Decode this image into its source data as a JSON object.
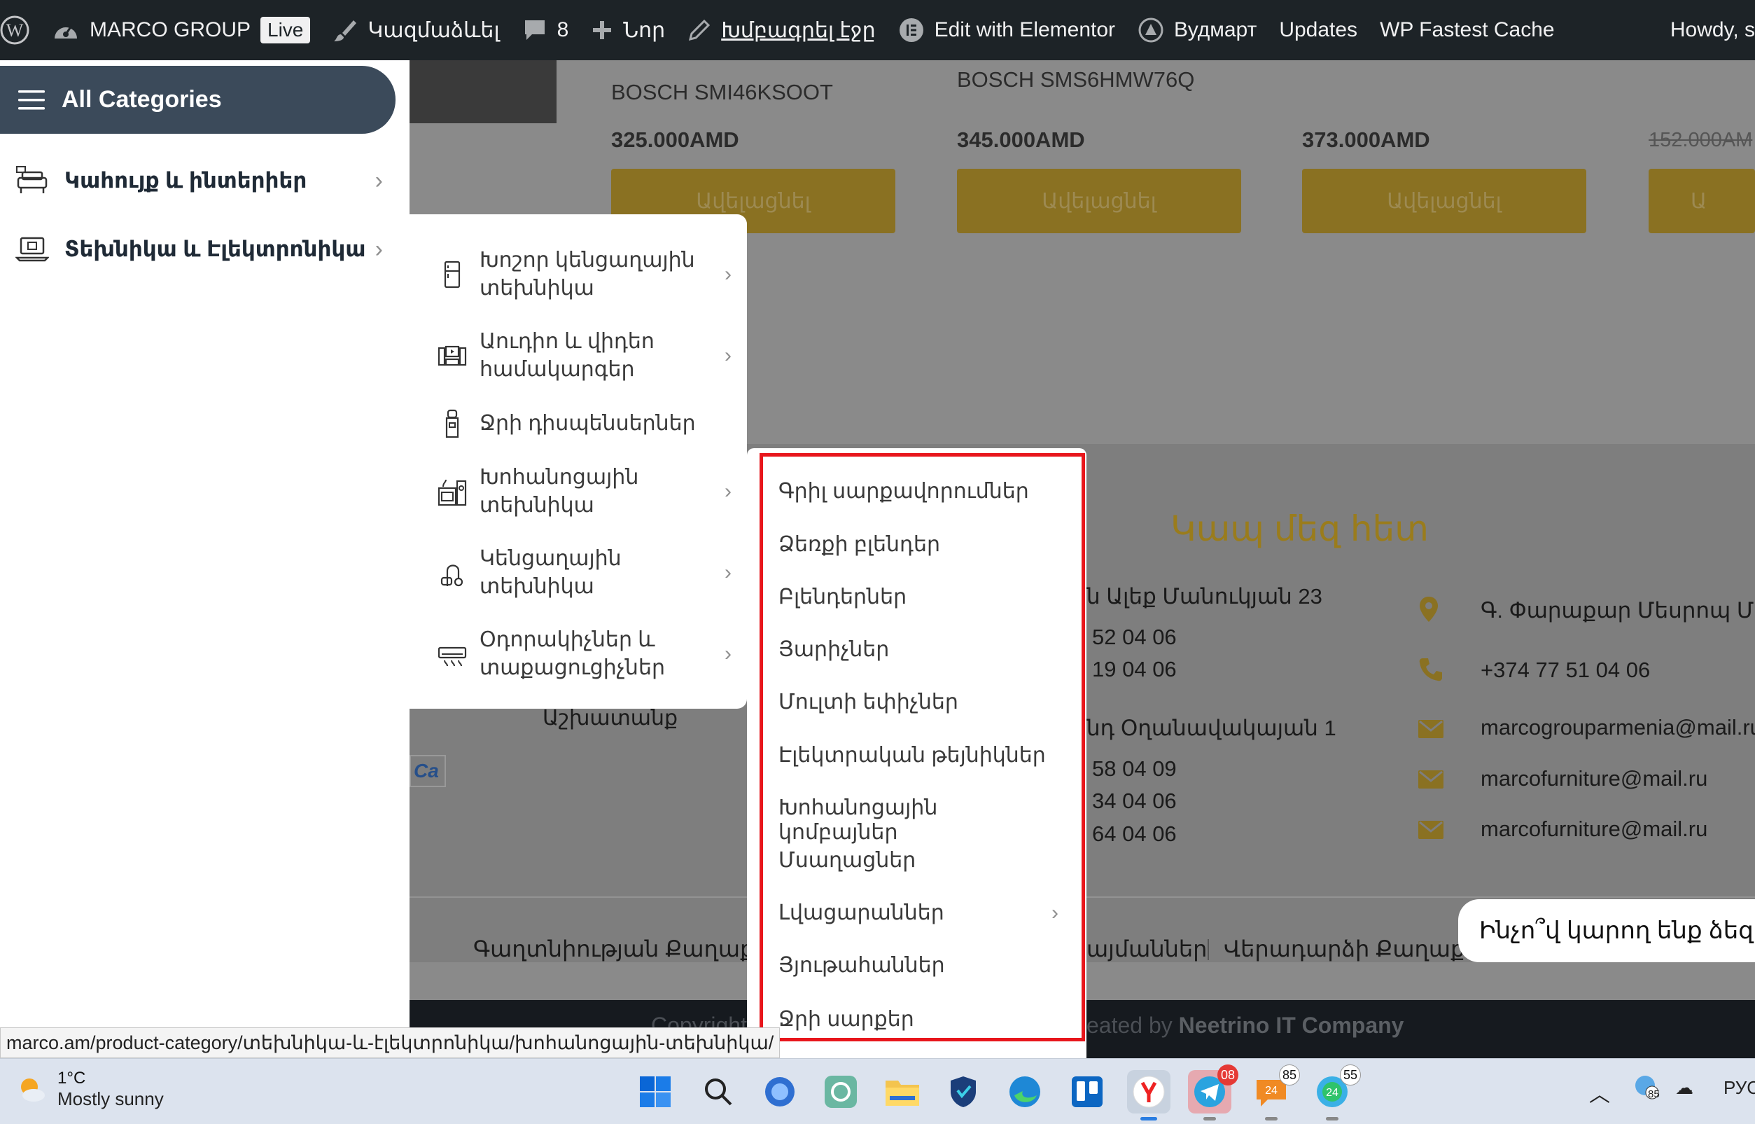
{
  "adminbar": {
    "site_name": "MARCO GROUP",
    "live_label": "Live",
    "customize_label": "Կազմաձևել",
    "comments_count": "8",
    "new_label": "Նոր",
    "edit_page_label": "Խմբագրել էջը",
    "elementor_label": "Edit with Elementor",
    "theme_label": "Вудмарт",
    "updates_label": "Updates",
    "cache_label": "WP Fastest Cache",
    "howdy_label": "Howdy, s"
  },
  "products": [
    {
      "name": "BOSCH SMI46KSOOT",
      "price": "325.000AMD",
      "button": "Ավելացնել"
    },
    {
      "name": "BOSCH SMS6HMW76Q",
      "price": "345.000AMD",
      "button": "Ավելացնել"
    },
    {
      "name": "",
      "price": "373.000AMD",
      "button": "Ավելացնել"
    },
    {
      "name": "",
      "price": "152.000AM",
      "button": "Ա"
    }
  ],
  "footer": {
    "contact_title": "Կապ մեզ հետ",
    "addr1": "ն Ալեք Մանուկյան 23",
    "phone1a": "52 04 06",
    "phone1b": "19 04 06",
    "addr2": "նդ Օղանավակայան 1",
    "phone2a": "58 04 09",
    "phone2b": "34 04 06",
    "phone2c": "64 04 06",
    "addr3": "Գ. Փարաքար Մեսրոպ Մաշ",
    "phone3": "+374 77 51 04 06",
    "email1": "marcogrouparmenia@mail.ru",
    "email2": "marcofurniture@mail.ru",
    "email3": "marcofurniture@mail.ru",
    "work_label": "Աշխատանք",
    "pay_badge": "Ca",
    "link_privacy": "Գաղտնիության Քաղաքա",
    "link_terms": "այմաններ",
    "link_return": "Վերադարձի Քաղաքա",
    "copyright_pre": "Copyright",
    "copyright_mid": "eated by ",
    "copyright_company": "Neetrino IT Company"
  },
  "chat": {
    "text": "Ինչո՞վ կարող ենք ձեզ օ"
  },
  "sidebar": {
    "all_categories": "All Categories",
    "items": [
      {
        "label": "Կահույք և ինտերիեր",
        "icon": "furniture-icon"
      },
      {
        "label": "Տեխնիկա և Էլեկտրոնիկա",
        "icon": "laptop-icon"
      }
    ]
  },
  "dropdown_level2": [
    {
      "line1": "Խոշոր կենցաղային",
      "line2": "տեխնիկա",
      "icon": "fridge-icon",
      "has_children": true
    },
    {
      "line1": "Աուդիո և վիդեո",
      "line2": "համակարգեր",
      "icon": "audio-video-icon",
      "has_children": true
    },
    {
      "line1": "Ջրի դիսպենսերներ",
      "line2": "",
      "icon": "water-dispenser-icon",
      "has_children": false
    },
    {
      "line1": "Խոհանոցային",
      "line2": "տեխնիկա",
      "icon": "kitchen-appliance-icon",
      "has_children": true
    },
    {
      "line1": "Կենցաղային",
      "line2": "տեխնիկա",
      "icon": "vacuum-icon",
      "has_children": true
    },
    {
      "line1": "Օդորակիչներ և",
      "line2": "տաքացուցիչներ",
      "icon": "air-conditioner-icon",
      "has_children": true
    }
  ],
  "dropdown_level3": [
    {
      "label": "Գրիլ սարքավորումներ",
      "has_children": false
    },
    {
      "label": "Ձեռքի բլենդեր",
      "has_children": false
    },
    {
      "label": "Բլենդերներ",
      "has_children": false
    },
    {
      "label": "Յարիչներ",
      "has_children": false
    },
    {
      "label": "Մուլտի եփիչներ",
      "has_children": false
    },
    {
      "label": "Էլեկտրական թեյնիկներ",
      "has_children": false
    },
    {
      "label": "Խոհանոցային կոմբայներ",
      "has_children": false
    },
    {
      "label": "Մսաղացներ",
      "has_children": false
    },
    {
      "label": "Լվացարաններ",
      "has_children": true
    },
    {
      "label": "Յյութահաններ",
      "has_children": false
    },
    {
      "label": "Ջրի սարքեր",
      "has_children": false
    }
  ],
  "status_url": "marco.am/product-category/տեխնիկա-և-էլեկտրոնիկա/խոհանոցային-տեխնիկա/",
  "taskbar": {
    "temperature": "1°C",
    "weather": "Mostly sunny",
    "badge_telegram": "08",
    "badge_app1": "85",
    "badge_app2": "55",
    "tray_lang": "РУС",
    "tray_badge": "85"
  },
  "colors": {
    "accent_gold": "#9a7c1c",
    "highlight_red": "#e8161c",
    "allcat_bg": "#3b4a5a"
  }
}
